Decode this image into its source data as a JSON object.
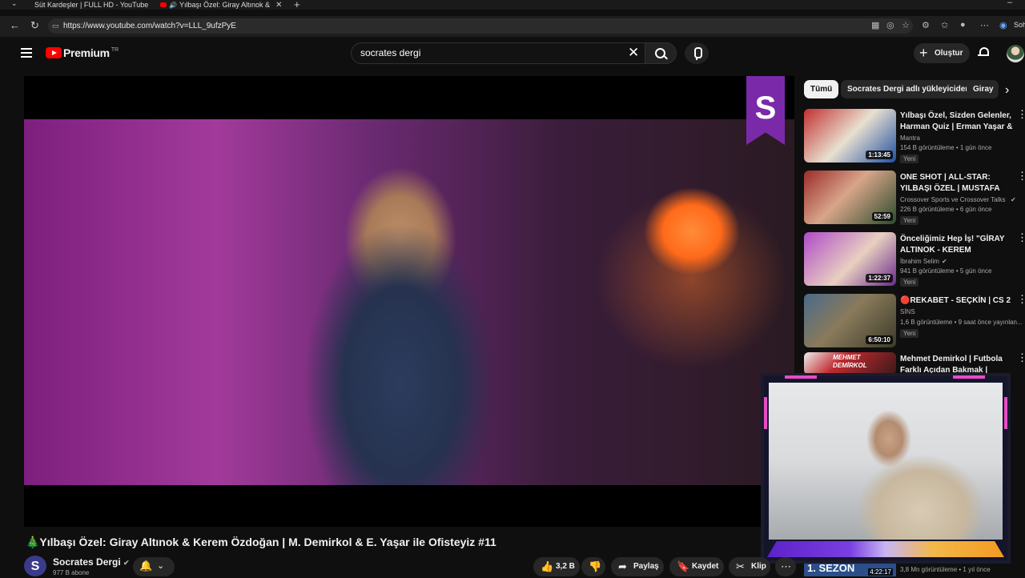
{
  "browser": {
    "tabs": [
      {
        "label": "Süt Kardeşler | FULL HD - YouTube"
      },
      {
        "label": "Yılbaşı Özel: Giray Altınok &"
      }
    ],
    "url": "https://www.youtube.com/watch?v=LLL_9ufzPyE",
    "profile_label": "Soh"
  },
  "header": {
    "logo_text": "Premium",
    "logo_region": "TR",
    "search_query": "socrates dergi",
    "create_label": "Oluştur"
  },
  "player": {
    "watermark_letter": "S"
  },
  "video": {
    "title": "🎄Yılbaşı Özel: Giray Altınok & Kerem Özdoğan | M. Demirkol & E. Yaşar ile Ofisteyiz #11",
    "channel_name": "Socrates Dergi",
    "channel_initial": "S",
    "subscribers": "977 B abone",
    "like_count": "3,2 B",
    "share_label": "Paylaş",
    "save_label": "Kaydet",
    "clip_label": "Klip"
  },
  "sidebar": {
    "chips": [
      "Tümü",
      "Socrates Dergi adlı yükleyiciden",
      "Giray"
    ],
    "recommendations": [
      {
        "title": "Yılbaşı Özel, Sizden Gelenler, Harman Quiz | Erman Yaşar & ...",
        "channel": "Mantra",
        "meta": "154 B görüntüleme • 1 gün önce",
        "badge": "Yeni",
        "duration": "1:13:45",
        "color": "#b8282e"
      },
      {
        "title": "ONE SHOT | ALL-STAR: YILBAŞI ÖZEL | MUSTAFA DEMİRTAŞ, ...",
        "channel": "Crossover Sports ve Crossover Talks",
        "meta": "226 B görüntüleme • 6 gün önce",
        "badge": "Yeni",
        "duration": "52:59",
        "color": "#9a2c2a"
      },
      {
        "title": "Önceliğimiz Hep İş! \"GİRAY ALTINOK - KEREM ÖZDOĞAN\" ...",
        "channel": "İbrahim Selim",
        "meta": "941 B görüntüleme • 5 gün önce",
        "badge": "Yeni",
        "duration": "1:22:37",
        "color": "#8a3aa8"
      },
      {
        "title": "🔴REKABET - SEÇKİN | CS 2",
        "channel": "SİNS",
        "meta": "1,6 B görüntüleme • 9 saat önce yayınlan...",
        "badge": "Yeni",
        "duration": "6:50:10",
        "color": "#6a6a4a"
      },
      {
        "title": "Mehmet Demirkol | Futbola Farklı Açıdan Bakmak | Kimsin...",
        "channel": "",
        "meta": "",
        "badge": "",
        "duration": "",
        "color": "#7a2a2a",
        "thumb_text": "MEHMET DEMİRKOL"
      }
    ],
    "season": {
      "thumb_text": "1. SEZON",
      "duration": "4:22:17",
      "meta": "3,8 Mn görüntüleme • 1 yıl önce"
    }
  }
}
